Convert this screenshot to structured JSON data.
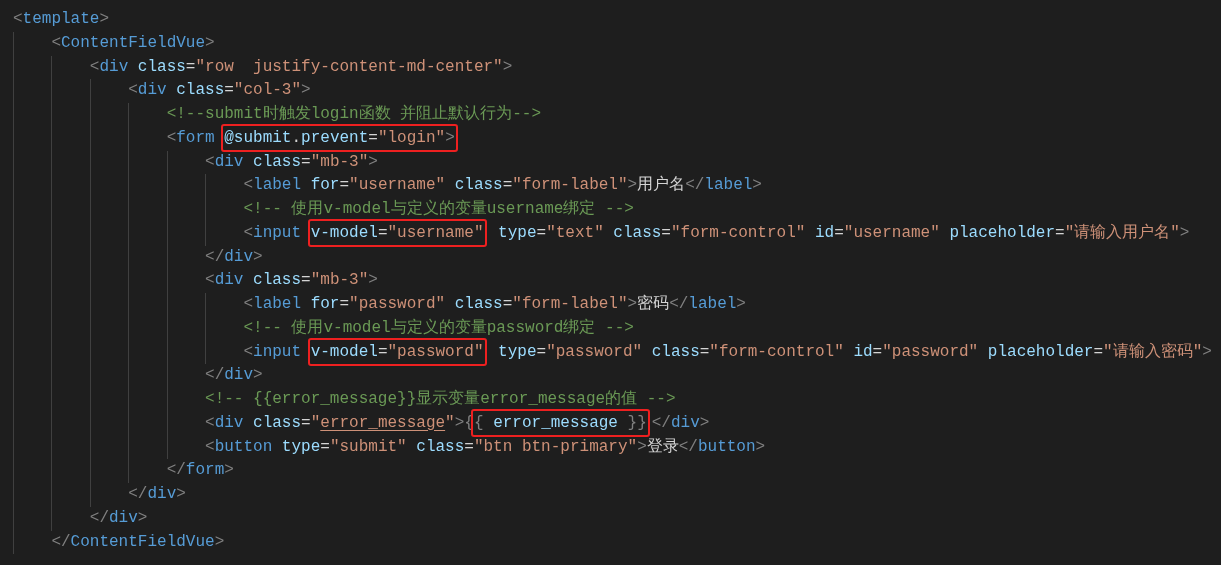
{
  "editor": {
    "lines": [
      {
        "tokens": [
          {
            "kind": "bracket",
            "text": "<"
          },
          {
            "kind": "tag",
            "text": "template"
          },
          {
            "kind": "bracket",
            "text": ">"
          }
        ],
        "children": [
          {
            "tokens": [
              {
                "kind": "bracket",
                "text": "<"
              },
              {
                "kind": "tag",
                "text": "ContentFieldVue"
              },
              {
                "kind": "bracket",
                "text": ">"
              }
            ],
            "children": [
              {
                "tokens": [
                  {
                    "kind": "bracket",
                    "text": "<"
                  },
                  {
                    "kind": "tag",
                    "text": "div"
                  },
                  {
                    "kind": "attribute",
                    "text": " class"
                  },
                  {
                    "kind": "plain",
                    "text": "="
                  },
                  {
                    "kind": "string",
                    "text": "\"row  justify-content-md-center\""
                  },
                  {
                    "kind": "bracket",
                    "text": ">"
                  }
                ],
                "children": [
                  {
                    "tokens": [
                      {
                        "kind": "bracket",
                        "text": "<"
                      },
                      {
                        "kind": "tag",
                        "text": "div"
                      },
                      {
                        "kind": "attribute",
                        "text": " class"
                      },
                      {
                        "kind": "plain",
                        "text": "="
                      },
                      {
                        "kind": "string",
                        "text": "\"col-3\""
                      },
                      {
                        "kind": "bracket",
                        "text": ">"
                      }
                    ],
                    "children": [
                      {
                        "tokens": [
                          {
                            "kind": "comment",
                            "text": "<!--submit时触发login函数 并阻止默认行为-->"
                          }
                        ]
                      },
                      {
                        "tokens": [
                          {
                            "kind": "bracket",
                            "text": "<"
                          },
                          {
                            "kind": "tag",
                            "text": "form "
                          },
                          {
                            "kind": "highlight",
                            "tokens": [
                              {
                                "kind": "attribute",
                                "text": "@submit"
                              },
                              {
                                "kind": "plain",
                                "text": "."
                              },
                              {
                                "kind": "attribute",
                                "text": "prevent"
                              },
                              {
                                "kind": "plain",
                                "text": "="
                              },
                              {
                                "kind": "string",
                                "text": "\"login\""
                              },
                              {
                                "kind": "bracket",
                                "text": ">"
                              }
                            ]
                          }
                        ],
                        "children": [
                          {
                            "tokens": [
                              {
                                "kind": "bracket",
                                "text": "<"
                              },
                              {
                                "kind": "tag",
                                "text": "div"
                              },
                              {
                                "kind": "attribute",
                                "text": " class"
                              },
                              {
                                "kind": "plain",
                                "text": "="
                              },
                              {
                                "kind": "string",
                                "text": "\"mb-3\""
                              },
                              {
                                "kind": "bracket",
                                "text": ">"
                              }
                            ],
                            "children": [
                              {
                                "tokens": [
                                  {
                                    "kind": "bracket",
                                    "text": "<"
                                  },
                                  {
                                    "kind": "tag",
                                    "text": "label"
                                  },
                                  {
                                    "kind": "attribute",
                                    "text": " for"
                                  },
                                  {
                                    "kind": "plain",
                                    "text": "="
                                  },
                                  {
                                    "kind": "string",
                                    "text": "\"username\""
                                  },
                                  {
                                    "kind": "attribute",
                                    "text": " class"
                                  },
                                  {
                                    "kind": "plain",
                                    "text": "="
                                  },
                                  {
                                    "kind": "string",
                                    "text": "\"form-label\""
                                  },
                                  {
                                    "kind": "bracket",
                                    "text": ">"
                                  },
                                  {
                                    "kind": "plain",
                                    "text": "用户名"
                                  },
                                  {
                                    "kind": "bracket",
                                    "text": "</"
                                  },
                                  {
                                    "kind": "tag",
                                    "text": "label"
                                  },
                                  {
                                    "kind": "bracket",
                                    "text": ">"
                                  }
                                ]
                              },
                              {
                                "tokens": [
                                  {
                                    "kind": "comment",
                                    "text": "<!-- 使用v-model与定义的变量username绑定 -->"
                                  }
                                ]
                              },
                              {
                                "tokens": [
                                  {
                                    "kind": "bracket",
                                    "text": "<"
                                  },
                                  {
                                    "kind": "tag",
                                    "text": "input "
                                  },
                                  {
                                    "kind": "highlight",
                                    "tokens": [
                                      {
                                        "kind": "attribute",
                                        "text": "v-model"
                                      },
                                      {
                                        "kind": "plain",
                                        "text": "="
                                      },
                                      {
                                        "kind": "string",
                                        "text": "\"username\""
                                      }
                                    ]
                                  },
                                  {
                                    "kind": "attribute",
                                    "text": " type"
                                  },
                                  {
                                    "kind": "plain",
                                    "text": "="
                                  },
                                  {
                                    "kind": "string",
                                    "text": "\"text\""
                                  },
                                  {
                                    "kind": "attribute",
                                    "text": " class"
                                  },
                                  {
                                    "kind": "plain",
                                    "text": "="
                                  },
                                  {
                                    "kind": "string",
                                    "text": "\"form-control\""
                                  },
                                  {
                                    "kind": "attribute",
                                    "text": " id"
                                  },
                                  {
                                    "kind": "plain",
                                    "text": "="
                                  },
                                  {
                                    "kind": "string",
                                    "text": "\"username\""
                                  },
                                  {
                                    "kind": "attribute",
                                    "text": " placeholder"
                                  },
                                  {
                                    "kind": "plain",
                                    "text": "="
                                  },
                                  {
                                    "kind": "string",
                                    "text": "\"请输入用户名\""
                                  },
                                  {
                                    "kind": "bracket",
                                    "text": ">"
                                  }
                                ]
                              }
                            ],
                            "close": [
                              {
                                "kind": "bracket",
                                "text": "</"
                              },
                              {
                                "kind": "tag",
                                "text": "div"
                              },
                              {
                                "kind": "bracket",
                                "text": ">"
                              }
                            ]
                          },
                          {
                            "tokens": [
                              {
                                "kind": "bracket",
                                "text": "<"
                              },
                              {
                                "kind": "tag",
                                "text": "div"
                              },
                              {
                                "kind": "attribute",
                                "text": " class"
                              },
                              {
                                "kind": "plain",
                                "text": "="
                              },
                              {
                                "kind": "string",
                                "text": "\"mb-3\""
                              },
                              {
                                "kind": "bracket",
                                "text": ">"
                              }
                            ],
                            "children": [
                              {
                                "tokens": [
                                  {
                                    "kind": "bracket",
                                    "text": "<"
                                  },
                                  {
                                    "kind": "tag",
                                    "text": "label"
                                  },
                                  {
                                    "kind": "attribute",
                                    "text": " for"
                                  },
                                  {
                                    "kind": "plain",
                                    "text": "="
                                  },
                                  {
                                    "kind": "string",
                                    "text": "\"password\""
                                  },
                                  {
                                    "kind": "attribute",
                                    "text": " class"
                                  },
                                  {
                                    "kind": "plain",
                                    "text": "="
                                  },
                                  {
                                    "kind": "string",
                                    "text": "\"form-label\""
                                  },
                                  {
                                    "kind": "bracket",
                                    "text": ">"
                                  },
                                  {
                                    "kind": "plain",
                                    "text": "密码"
                                  },
                                  {
                                    "kind": "bracket",
                                    "text": "</"
                                  },
                                  {
                                    "kind": "tag",
                                    "text": "label"
                                  },
                                  {
                                    "kind": "bracket",
                                    "text": ">"
                                  }
                                ]
                              },
                              {
                                "tokens": [
                                  {
                                    "kind": "comment",
                                    "text": "<!-- 使用v-model与定义的变量password绑定 -->"
                                  }
                                ]
                              },
                              {
                                "tokens": [
                                  {
                                    "kind": "bracket",
                                    "text": "<"
                                  },
                                  {
                                    "kind": "tag",
                                    "text": "input "
                                  },
                                  {
                                    "kind": "highlight",
                                    "tokens": [
                                      {
                                        "kind": "attribute",
                                        "text": "v-model"
                                      },
                                      {
                                        "kind": "plain",
                                        "text": "="
                                      },
                                      {
                                        "kind": "string",
                                        "text": "\"password\""
                                      }
                                    ]
                                  },
                                  {
                                    "kind": "attribute",
                                    "text": " type"
                                  },
                                  {
                                    "kind": "plain",
                                    "text": "="
                                  },
                                  {
                                    "kind": "string",
                                    "text": "\"password\""
                                  },
                                  {
                                    "kind": "attribute",
                                    "text": " class"
                                  },
                                  {
                                    "kind": "plain",
                                    "text": "="
                                  },
                                  {
                                    "kind": "string",
                                    "text": "\"form-control\""
                                  },
                                  {
                                    "kind": "attribute",
                                    "text": " id"
                                  },
                                  {
                                    "kind": "plain",
                                    "text": "="
                                  },
                                  {
                                    "kind": "string",
                                    "text": "\"password\""
                                  },
                                  {
                                    "kind": "attribute",
                                    "text": " placeholder"
                                  },
                                  {
                                    "kind": "plain",
                                    "text": "="
                                  },
                                  {
                                    "kind": "string",
                                    "text": "\"请输入密码\""
                                  },
                                  {
                                    "kind": "bracket",
                                    "text": ">"
                                  }
                                ]
                              }
                            ],
                            "close": [
                              {
                                "kind": "bracket",
                                "text": "</"
                              },
                              {
                                "kind": "tag",
                                "text": "div"
                              },
                              {
                                "kind": "bracket",
                                "text": ">"
                              }
                            ]
                          },
                          {
                            "tokens": [
                              {
                                "kind": "comment",
                                "text": "<!-- {{error_message}}显示变量error_message的值 -->"
                              }
                            ]
                          },
                          {
                            "tokens": [
                              {
                                "kind": "bracket",
                                "text": "<"
                              },
                              {
                                "kind": "tag",
                                "text": "div"
                              },
                              {
                                "kind": "attribute",
                                "text": " class"
                              },
                              {
                                "kind": "plain",
                                "text": "="
                              },
                              {
                                "kind": "string",
                                "text": "\""
                              },
                              {
                                "kind": "flagged",
                                "text": "error_message"
                              },
                              {
                                "kind": "string",
                                "text": "\""
                              },
                              {
                                "kind": "bracket",
                                "text": ">{"
                              },
                              {
                                "kind": "highlight",
                                "tokens": [
                                  {
                                    "kind": "bracket",
                                    "text": "{"
                                  },
                                  {
                                    "kind": "attribute",
                                    "text": " error_message "
                                  },
                                  {
                                    "kind": "bracket",
                                    "text": "}}"
                                  }
                                ]
                              },
                              {
                                "kind": "bracket",
                                "text": "</"
                              },
                              {
                                "kind": "tag",
                                "text": "div"
                              },
                              {
                                "kind": "bracket",
                                "text": ">"
                              }
                            ]
                          },
                          {
                            "tokens": [
                              {
                                "kind": "bracket",
                                "text": "<"
                              },
                              {
                                "kind": "tag",
                                "text": "button"
                              },
                              {
                                "kind": "attribute",
                                "text": " type"
                              },
                              {
                                "kind": "plain",
                                "text": "="
                              },
                              {
                                "kind": "string",
                                "text": "\"submit\""
                              },
                              {
                                "kind": "attribute",
                                "text": " class"
                              },
                              {
                                "kind": "plain",
                                "text": "="
                              },
                              {
                                "kind": "string",
                                "text": "\"btn btn-primary\""
                              },
                              {
                                "kind": "bracket",
                                "text": ">"
                              },
                              {
                                "kind": "plain",
                                "text": "登录"
                              },
                              {
                                "kind": "bracket",
                                "text": "</"
                              },
                              {
                                "kind": "tag",
                                "text": "button"
                              },
                              {
                                "kind": "bracket",
                                "text": ">"
                              }
                            ]
                          }
                        ],
                        "close": [
                          {
                            "kind": "bracket",
                            "text": "</"
                          },
                          {
                            "kind": "tag",
                            "text": "form"
                          },
                          {
                            "kind": "bracket",
                            "text": ">"
                          }
                        ]
                      }
                    ],
                    "close": [
                      {
                        "kind": "bracket",
                        "text": "</"
                      },
                      {
                        "kind": "tag",
                        "text": "div"
                      },
                      {
                        "kind": "bracket",
                        "text": ">"
                      }
                    ]
                  }
                ],
                "close": [
                  {
                    "kind": "bracket",
                    "text": "</"
                  },
                  {
                    "kind": "tag",
                    "text": "div"
                  },
                  {
                    "kind": "bracket",
                    "text": ">"
                  }
                ]
              }
            ],
            "close": [
              {
                "kind": "bracket",
                "text": "</"
              },
              {
                "kind": "tag",
                "text": "ContentFieldVue"
              },
              {
                "kind": "bracket",
                "text": ">"
              }
            ]
          }
        ]
      }
    ]
  }
}
